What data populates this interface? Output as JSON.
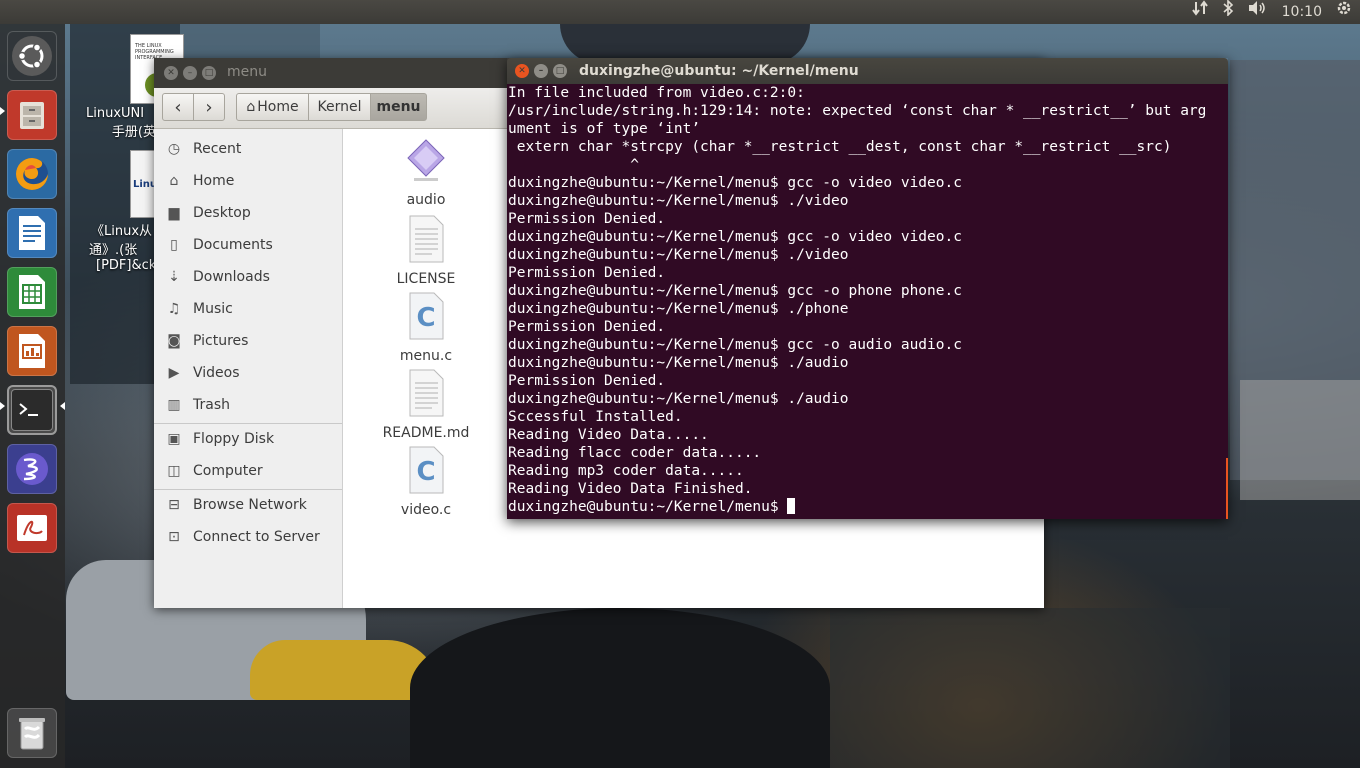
{
  "top_panel": {
    "clock": "10:10",
    "icons": [
      "network-updown-icon",
      "bluetooth-icon",
      "volume-icon",
      "settings-gear-icon"
    ]
  },
  "launcher": {
    "items": [
      {
        "name": "ubuntu-dash",
        "icon": "ubuntu-logo-icon"
      },
      {
        "name": "files",
        "icon": "file-cabinet-icon"
      },
      {
        "name": "firefox",
        "icon": "firefox-icon"
      },
      {
        "name": "libreoffice-writer",
        "icon": "writer-icon"
      },
      {
        "name": "libreoffice-calc",
        "icon": "calc-icon"
      },
      {
        "name": "libreoffice-impress",
        "icon": "impress-icon"
      },
      {
        "name": "terminal",
        "icon": "terminal-icon"
      },
      {
        "name": "emacs",
        "icon": "emacs-icon"
      },
      {
        "name": "document-viewer",
        "icon": "pdf-viewer-icon"
      },
      {
        "name": "trash",
        "icon": "trash-icon"
      }
    ]
  },
  "desktop_icons": [
    {
      "line1": "LinuxUNI",
      "line2": "手册(英"
    },
    {
      "line1": "《Linux从",
      "line2": "通》.(张",
      "line3": "[PDF]&ck"
    }
  ],
  "file_manager": {
    "title": "menu",
    "breadcrumbs": [
      "Home",
      "Kernel",
      "menu"
    ],
    "sidebar": {
      "places": [
        "Recent",
        "Home",
        "Desktop",
        "Documents",
        "Downloads",
        "Music",
        "Pictures",
        "Videos",
        "Trash"
      ],
      "devices": [
        "Floppy Disk",
        "Computer"
      ],
      "network": [
        "Browse Network",
        "Connect to Server"
      ]
    },
    "files": [
      {
        "name": "audio",
        "type": "executable"
      },
      {
        "name": "LICENSE",
        "type": "text"
      },
      {
        "name": "menu.c",
        "type": "c-source"
      },
      {
        "name": "README.md",
        "type": "text"
      },
      {
        "name": "video.c",
        "type": "c-source"
      }
    ]
  },
  "terminal": {
    "title": "duxingzhe@ubuntu: ~/Kernel/menu",
    "lines": [
      "In file included from video.c:2:0:",
      "/usr/include/string.h:129:14: note: expected ‘const char * __restrict__’ but arg",
      "ument is of type ‘int’",
      " extern char *strcpy (char *__restrict __dest, const char *__restrict __src)",
      "              ^",
      "duxingzhe@ubuntu:~/Kernel/menu$ gcc -o video video.c",
      "duxingzhe@ubuntu:~/Kernel/menu$ ./video",
      "Permission Denied.",
      "duxingzhe@ubuntu:~/Kernel/menu$ gcc -o video video.c",
      "duxingzhe@ubuntu:~/Kernel/menu$ ./video",
      "Permission Denied.",
      "duxingzhe@ubuntu:~/Kernel/menu$ gcc -o phone phone.c",
      "duxingzhe@ubuntu:~/Kernel/menu$ ./phone",
      "Permission Denied.",
      "duxingzhe@ubuntu:~/Kernel/menu$ gcc -o audio audio.c",
      "duxingzhe@ubuntu:~/Kernel/menu$ ./audio",
      "Permission Denied.",
      "duxingzhe@ubuntu:~/Kernel/menu$ ./audio",
      "Sccessful Installed.",
      "Reading Video Data.....",
      "Reading flacc coder data.....",
      "Reading mp3 coder data.....",
      "Reading Video Data Finished."
    ],
    "prompt": "duxingzhe@ubuntu:~/Kernel/menu$"
  },
  "colors": {
    "terminal_bg": "#300a24",
    "panel_bg": "#3c3b37",
    "close_button": "#e95420"
  }
}
